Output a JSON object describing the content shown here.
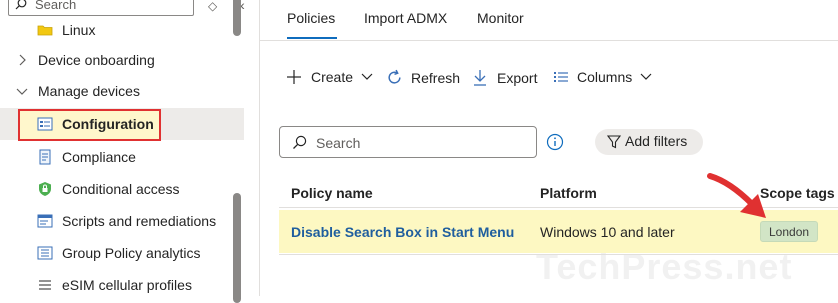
{
  "sidebar": {
    "search_placeholder": "Search",
    "controls": {
      "expand": "◇",
      "collapse": "«"
    },
    "items": [
      {
        "label": "Linux",
        "icon": "folder-icon"
      },
      {
        "label": "Device onboarding",
        "chevron": "chevron-right"
      },
      {
        "label": "Manage devices",
        "chevron": "chevron-down"
      },
      {
        "label": "Configuration",
        "icon": "configuration-icon",
        "selected": true
      },
      {
        "label": "Compliance",
        "icon": "compliance-icon"
      },
      {
        "label": "Conditional access",
        "icon": "lock-shield-icon"
      },
      {
        "label": "Scripts and remediations",
        "icon": "scripts-icon"
      },
      {
        "label": "Group Policy analytics",
        "icon": "group-policy-icon"
      },
      {
        "label": "eSIM cellular profiles",
        "icon": "esim-icon"
      }
    ]
  },
  "tabs": [
    {
      "label": "Policies",
      "active": true
    },
    {
      "label": "Import ADMX"
    },
    {
      "label": "Monitor"
    }
  ],
  "toolbar": {
    "create": "Create",
    "refresh": "Refresh",
    "export": "Export",
    "columns": "Columns"
  },
  "filter": {
    "search_placeholder": "Search",
    "add_filters": "Add filters"
  },
  "table": {
    "columns": [
      "Policy name",
      "Platform",
      "Scope tags"
    ],
    "rows": [
      {
        "policy_name": "Disable Search Box in Start Menu",
        "platform": "Windows 10 and later",
        "scope_tag": "London"
      }
    ]
  },
  "watermark": "TechPress.net",
  "colors": {
    "accent": "#0f6cbd",
    "highlight_row": "#fdf8c2",
    "annotation_red": "#e03131",
    "tag_bg": "#d2e5c6"
  }
}
